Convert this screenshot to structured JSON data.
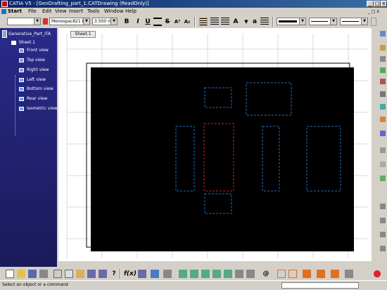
{
  "window": {
    "title": "CATIA V5 - [GenDrafting_part_1.CATDrawing (ReadOnly)]",
    "controls": [
      "_",
      "□",
      "x"
    ]
  },
  "menu": [
    "Start",
    "File",
    "Edit",
    "View",
    "Insert",
    "Tools",
    "Window",
    "Help"
  ],
  "toolbar": {
    "style_combo": "",
    "font_combo": "Monospac821 BT",
    "size_combo": "3.500 mm",
    "bold": "B",
    "italic": "I",
    "underline": "U",
    "line_color_combo": "",
    "line_type_combo": "",
    "line_thickness_combo": ""
  },
  "tree": {
    "root": "Generative_Part_ITA",
    "sheet": "Sheet.1",
    "views": [
      "Front view",
      "Top view",
      "Right view",
      "Left view",
      "Bottom view",
      "Rear view",
      "Isometric view"
    ]
  },
  "drawing": {
    "sheet_tab": "Sheet.1",
    "view_labels": [
      "Top view",
      "Isometric view",
      "Right view",
      "Front view",
      "Left view",
      "Rear view",
      "Bottom view"
    ],
    "active_color": "#cc2222",
    "frame_color": "#1f6fc0"
  },
  "status": {
    "text": "Select an object or a command"
  }
}
